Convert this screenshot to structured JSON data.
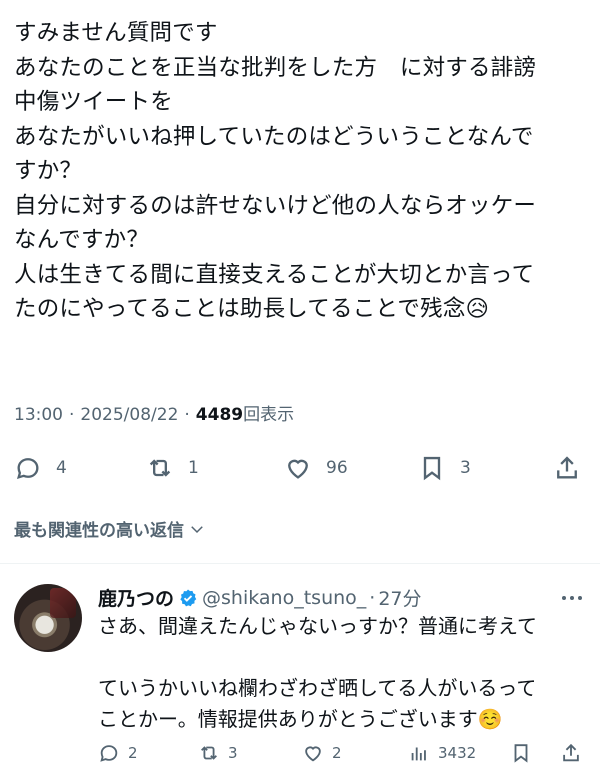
{
  "tweet": {
    "lines": [
      "すみません質問です",
      "あなたのことを正当な批判をした方　に対する誹謗",
      "中傷ツイートを",
      "あなたがいいね押していたのはどういうことなんで",
      "すか？",
      "自分に対するのは許せないけど他の人ならオッケー",
      "なんですか？",
      "人は生きてる間に直接支えることが大切とか言って",
      "たのにやってることは助長してることで残念😥"
    ],
    "time": "13:00",
    "date": "2025/08/22",
    "separator": "·",
    "views_count": "4489",
    "views_label": "回表示"
  },
  "actions": {
    "replies": "4",
    "retweets": "1",
    "likes": "96",
    "bookmarks": "3"
  },
  "sort_label": "最も関連性の高い返信",
  "reply": {
    "display_name": "鹿乃つの",
    "handle": "@shikano_tsuno_",
    "dot": "·",
    "time": "27分",
    "lines_1": [
      "さあ、間違えたんじゃないっすか？普通に考えて"
    ],
    "lines_2": [
      "ていうかいいね欄わざわざ晒してる人がいるって",
      "ことかー。情報提供ありがとうございます☺️"
    ],
    "actions": {
      "replies": "2",
      "retweets": "3",
      "likes": "2",
      "views": "3432"
    }
  },
  "colors": {
    "text": "#0f1419",
    "secondary": "#536471",
    "verified": "#1d9bf0",
    "divider": "#eff3f4"
  },
  "icons": [
    "reply-icon",
    "retweet-icon",
    "like-icon",
    "bookmark-icon",
    "share-icon",
    "chevron-down-icon",
    "verified-badge-icon",
    "more-icon",
    "views-icon"
  ]
}
